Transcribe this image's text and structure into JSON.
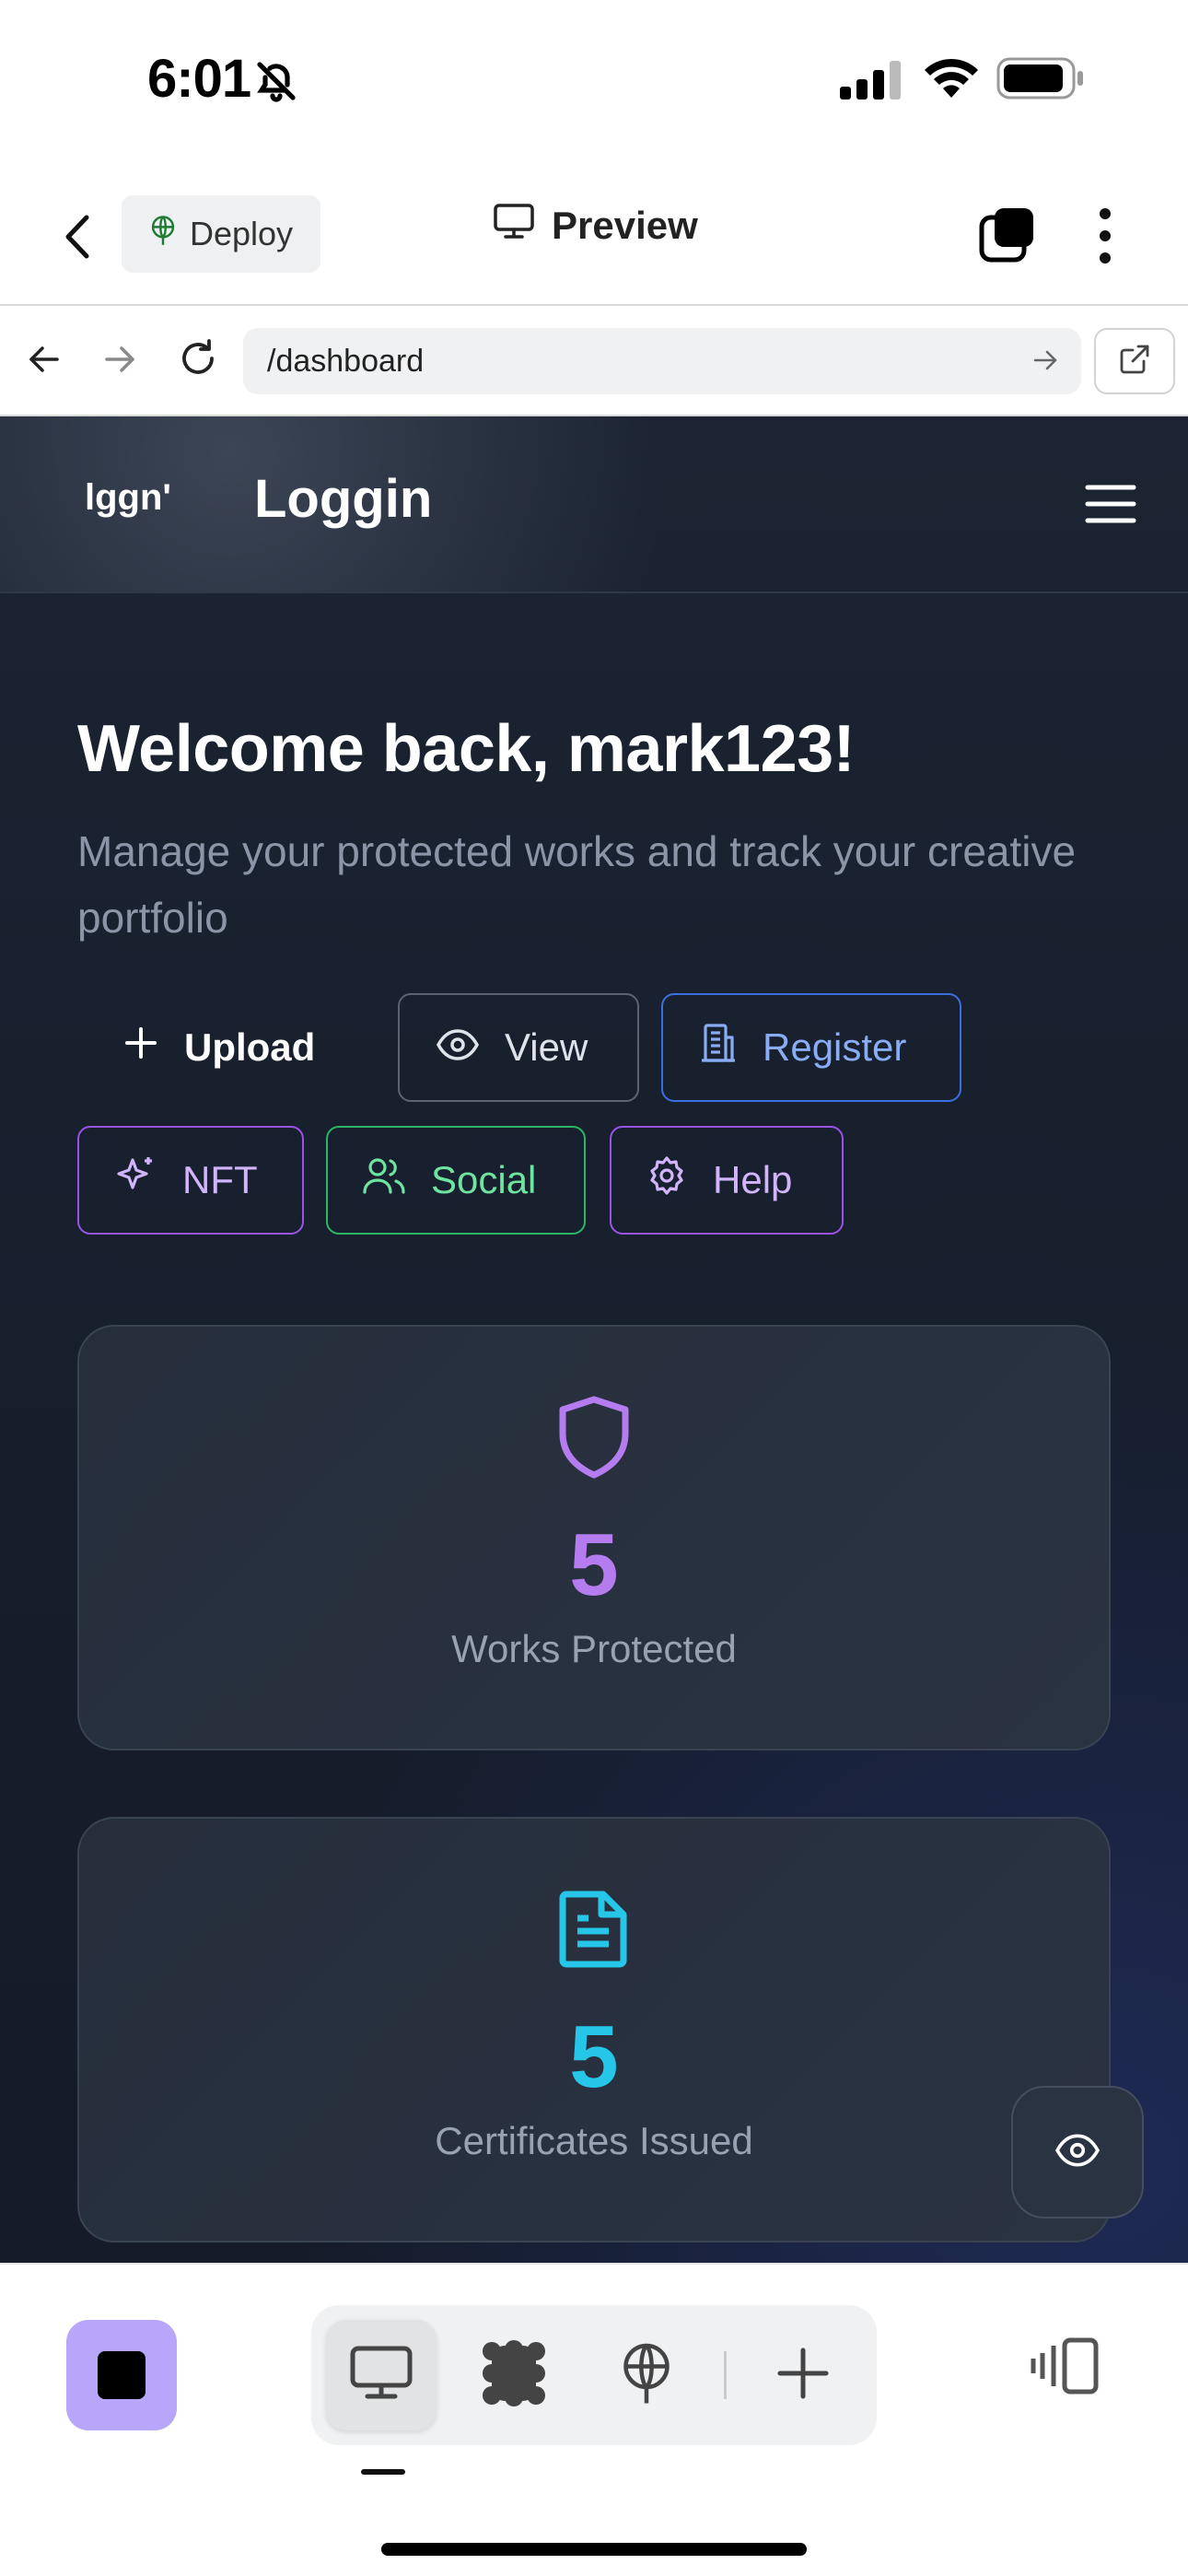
{
  "status_bar": {
    "time": "6:01"
  },
  "app_toolbar": {
    "deploy_label": "Deploy",
    "preview_label": "Preview"
  },
  "browser": {
    "url": "/dashboard"
  },
  "site": {
    "logo_mark": "lggn'",
    "logo_text": "Loggin",
    "welcome": "Welcome back, mark123!",
    "subtitle": "Manage your protected works and track your creative portfolio",
    "actions": {
      "upload": "Upload",
      "view": "View",
      "register": "Register",
      "nft": "NFT",
      "social": "Social",
      "help": "Help"
    },
    "stats": [
      {
        "value": "5",
        "label": "Works Protected",
        "color": "#b57cf0",
        "icon": "shield-icon"
      },
      {
        "value": "5",
        "label": "Certificates Issued",
        "color": "#26c6e8",
        "icon": "document-icon"
      }
    ]
  },
  "colors": {
    "background": "#161d2b",
    "accent_purple": "#9b52e6",
    "accent_green": "#2bb565",
    "accent_blue": "#3b6fe0",
    "stop_button": "#b8a6fb"
  }
}
